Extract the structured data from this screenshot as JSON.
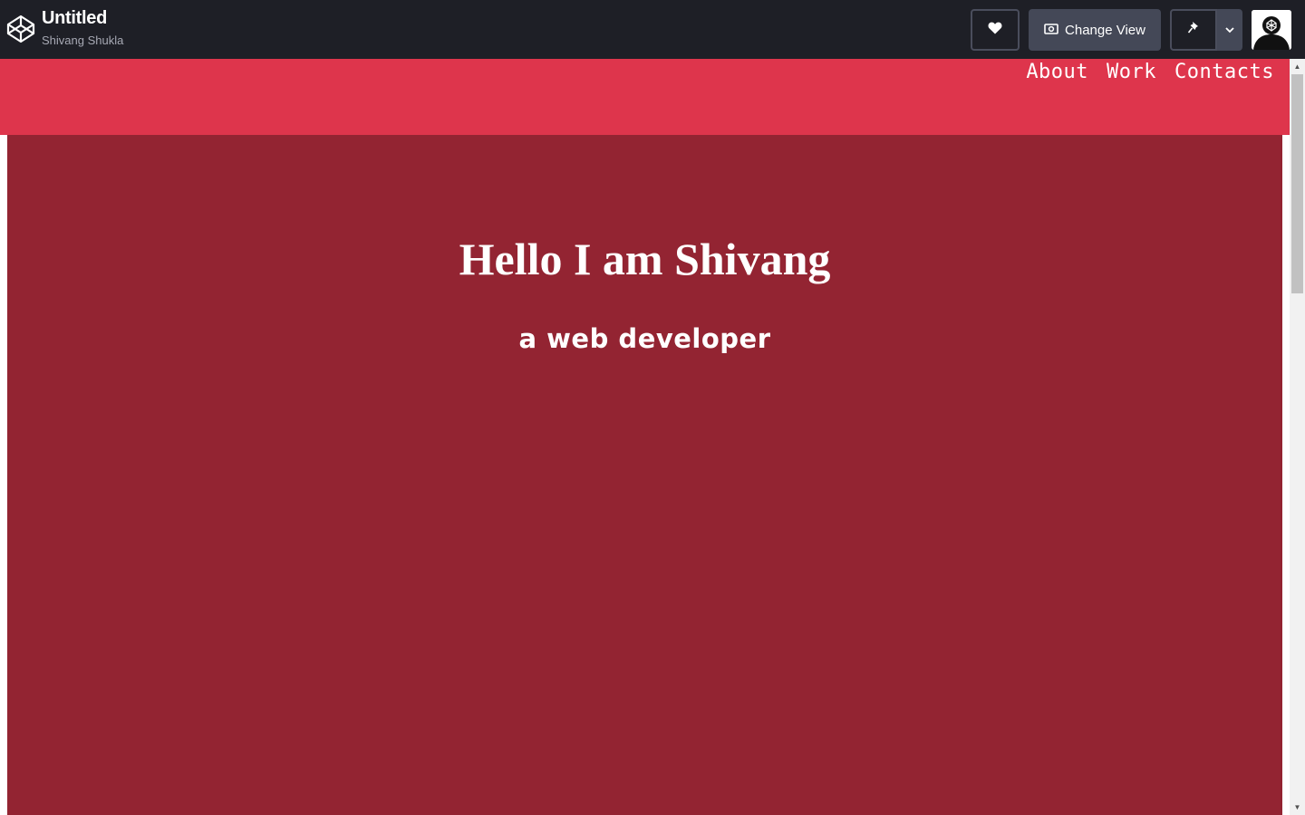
{
  "header": {
    "title": "Untitled",
    "author": "Shivang Shukla",
    "logo_icon": "codepen-logo-icon",
    "like_icon": "heart-icon",
    "change_view_label": "Change View",
    "change_view_icon": "eye-icon",
    "pin_icon": "pin-icon",
    "dropdown_icon": "chevron-down-icon"
  },
  "preview": {
    "nav": [
      "About",
      "Work",
      "Contacts"
    ],
    "hero_title": "Hello I am Shivang",
    "hero_subtitle": "a web developer"
  },
  "colors": {
    "topbar": "#1e1f26",
    "navbar": "#de354c",
    "hero": "#932432",
    "text": "#ffffff"
  }
}
